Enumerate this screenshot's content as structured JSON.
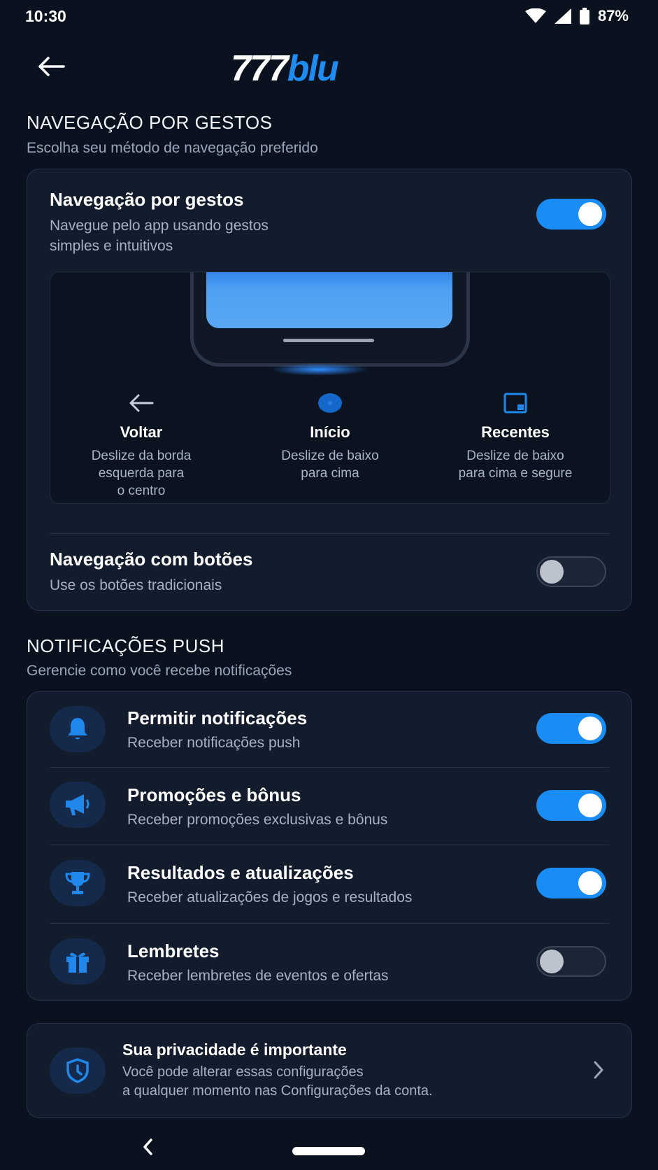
{
  "status": {
    "time": "10:30",
    "battery": "87%"
  },
  "header": {
    "logo_part1": "777",
    "logo_part2": "blu"
  },
  "gestures_section": {
    "title": "NAVEGAÇÃO POR GESTOS",
    "subtitle": "Escolha seu método de navegação preferido"
  },
  "gesture_nav": {
    "title": "Navegação por gestos",
    "subtitle_line1": "Navegue pelo app usando gestos",
    "subtitle_line2": "simples e intuitivos",
    "enabled": true
  },
  "gestures": [
    {
      "label": "Voltar",
      "desc": [
        "Deslize da borda",
        "esquerda para",
        "o centro"
      ],
      "icon": "arrow-left-icon"
    },
    {
      "label": "Início",
      "desc": [
        "Deslize de baixo",
        "para cima"
      ],
      "icon": "dot-icon"
    },
    {
      "label": "Recentes",
      "desc": [
        "Deslize de baixo",
        "para cima e segure"
      ],
      "icon": "recents-square-icon"
    }
  ],
  "button_nav": {
    "title": "Navegação com botões",
    "subtitle": "Use os botões tradicionais",
    "enabled": false
  },
  "push_section": {
    "title": "NOTIFICAÇÕES PUSH",
    "subtitle": "Gerencie como você recebe notificações"
  },
  "notifications": [
    {
      "title": "Permitir notificações",
      "subtitle": "Receber notificações push",
      "enabled": true,
      "icon": "bell-icon"
    },
    {
      "title": "Promoções e bônus",
      "subtitle": "Receber promoções exclusivas e bônus",
      "enabled": true,
      "icon": "megaphone-icon"
    },
    {
      "title": "Resultados e atualizações",
      "subtitle": "Receber atualizações de jogos e resultados",
      "enabled": true,
      "icon": "trophy-icon"
    },
    {
      "title": "Lembretes",
      "subtitle": "Receber lembretes de eventos e ofertas",
      "enabled": false,
      "icon": "gift-icon"
    }
  ],
  "privacy": {
    "title": "Sua privacidade é importante",
    "line1": "Você pode alterar essas configurações",
    "line2": "a qualquer momento nas Configurações da conta."
  },
  "colors": {
    "accent": "#1a8cf5",
    "background": "#0a1220",
    "card": "#121c2c"
  }
}
